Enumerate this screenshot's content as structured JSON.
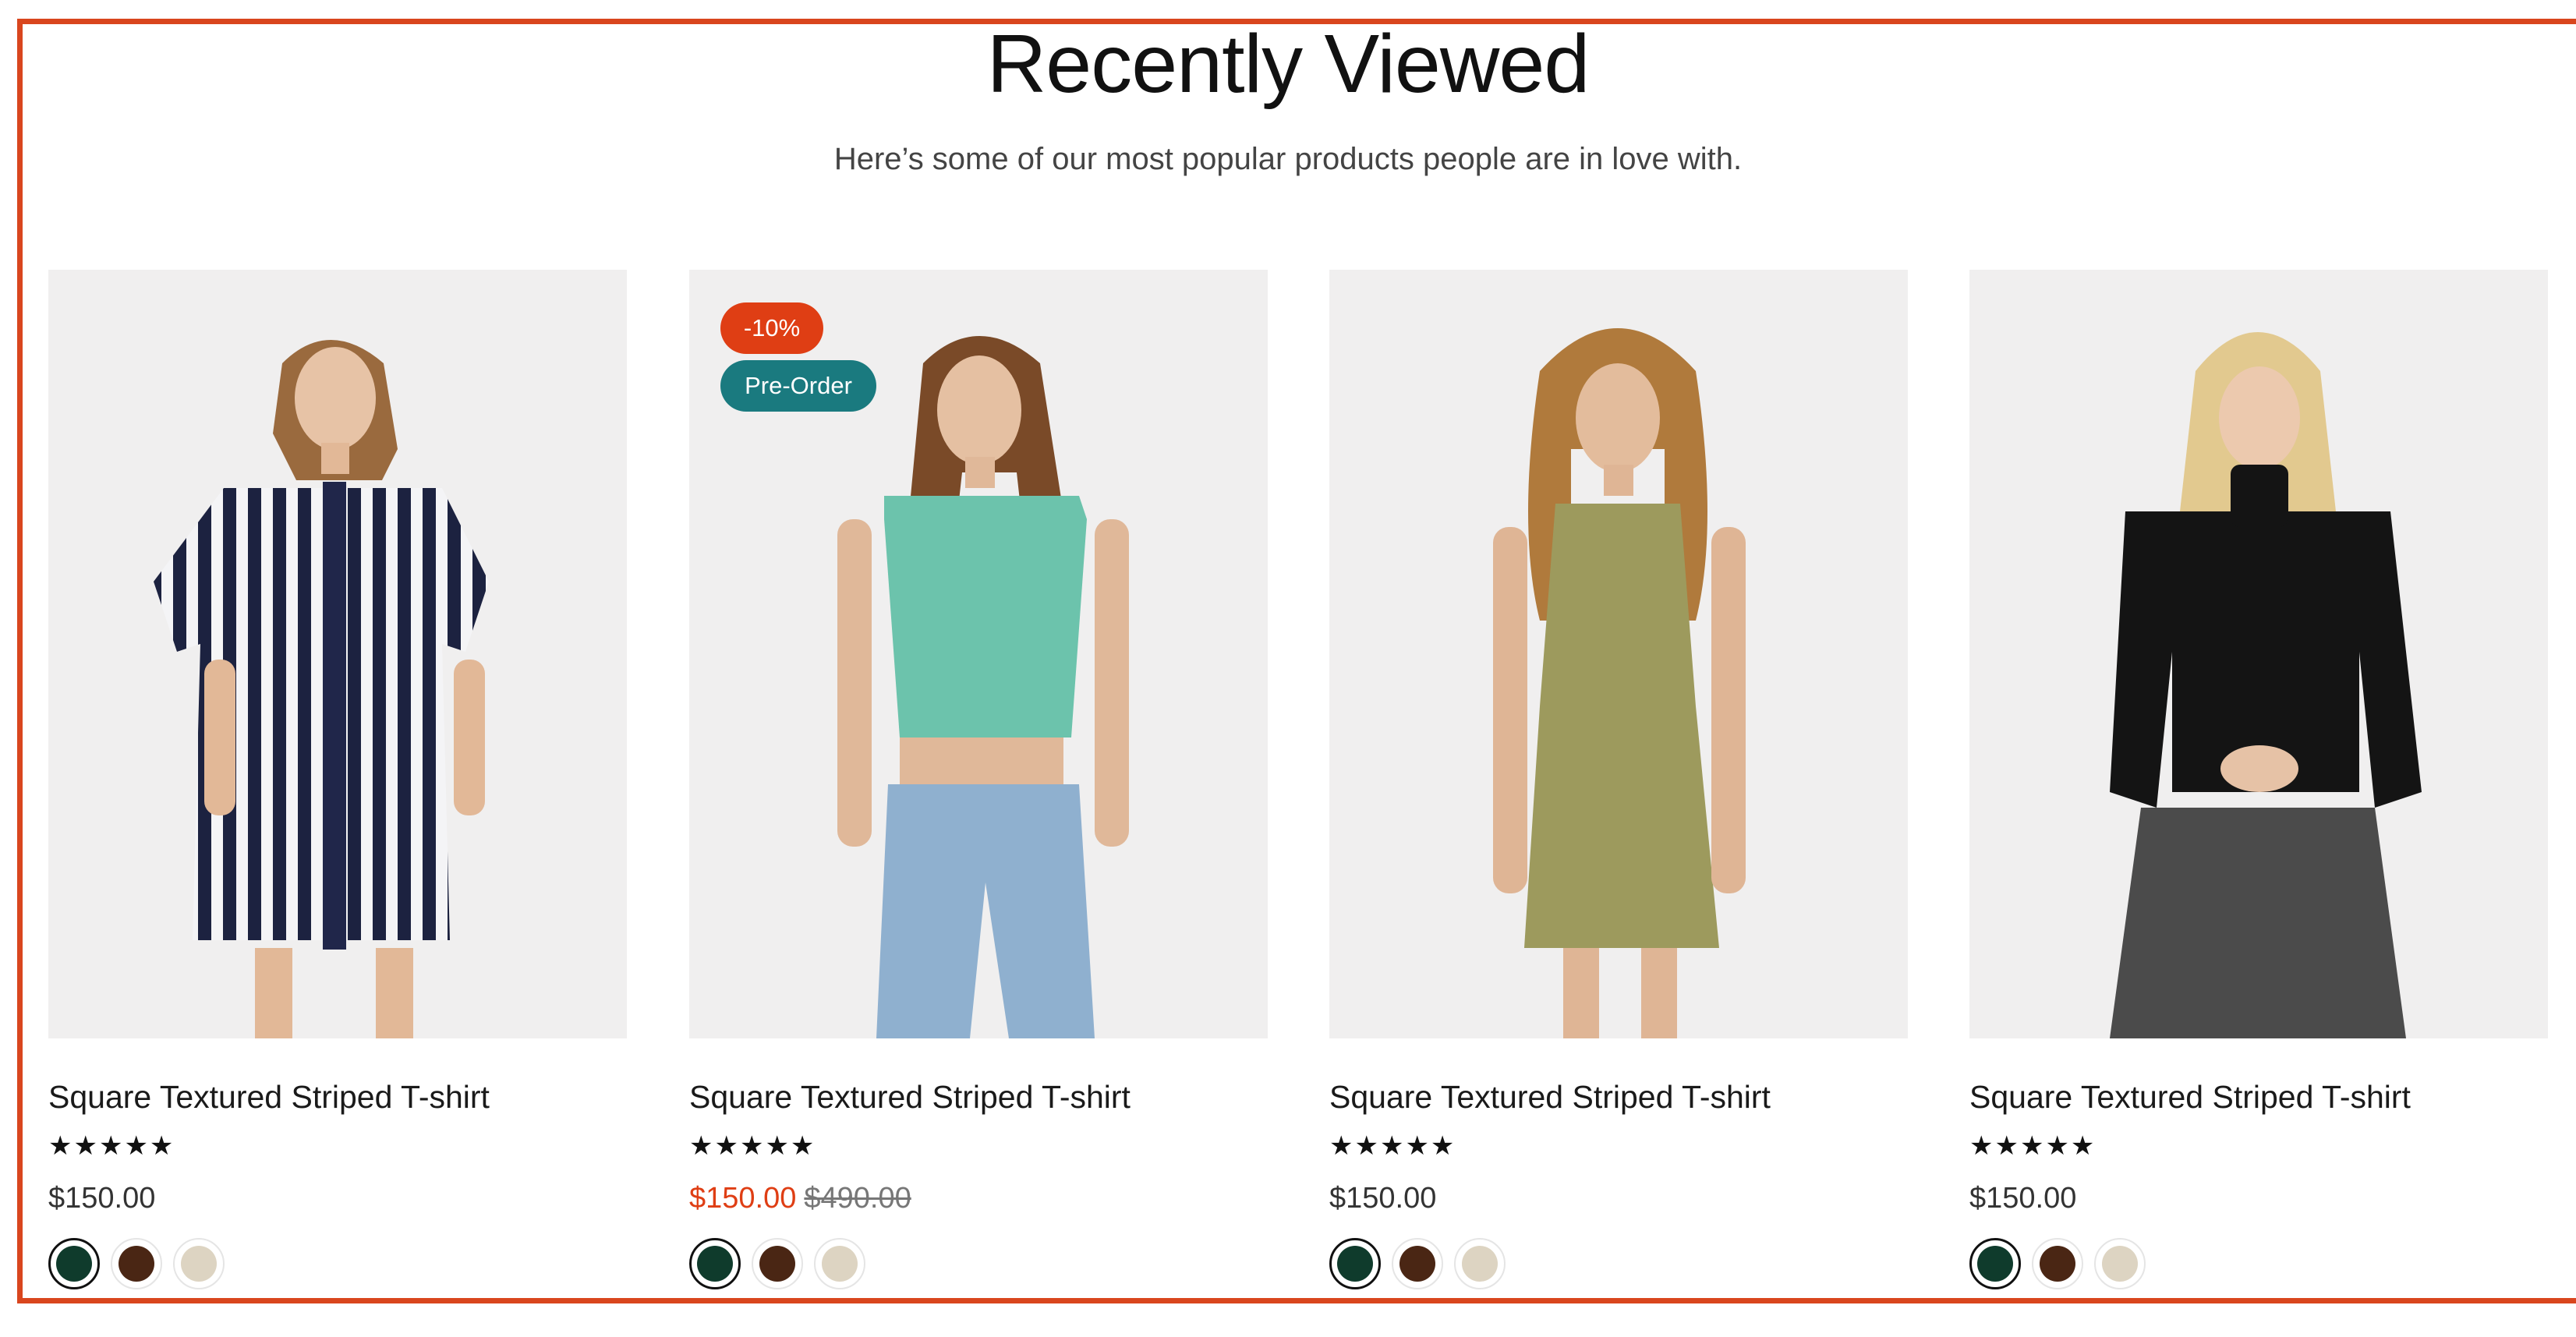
{
  "section": {
    "title": "Recently Viewed",
    "subtitle": "Here’s some of our most popular products people are in love with."
  },
  "colors": {
    "accent": "#d9461e",
    "sale": "#df3e14",
    "preorder": "#1a7a7f"
  },
  "swatch_colors": [
    "#0f3b2c",
    "#4a2614",
    "#ddd4c2"
  ],
  "products": [
    {
      "name": "Square Textured Striped T-shirt",
      "rating": 5,
      "stars": "★★★★★",
      "price": "$150.00",
      "old_price": "",
      "badges": [],
      "image": "striped-shirt-dress-photo"
    },
    {
      "name": "Square Textured Striped T-shirt",
      "rating": 5,
      "stars": "★★★★★",
      "price": "$150.00",
      "old_price": "$490.00",
      "badges": [
        "-10%",
        "Pre-Order"
      ],
      "image": "green-crop-top-jeans-photo"
    },
    {
      "name": "Square Textured Striped T-shirt",
      "rating": 5,
      "stars": "★★★★★",
      "price": "$150.00",
      "old_price": "",
      "badges": [],
      "image": "olive-knit-dress-photo"
    },
    {
      "name": "Square Textured Striped T-shirt",
      "rating": 5,
      "stars": "★★★★★",
      "price": "$150.00",
      "old_price": "",
      "badges": [],
      "image": "black-turtleneck-photo"
    }
  ]
}
